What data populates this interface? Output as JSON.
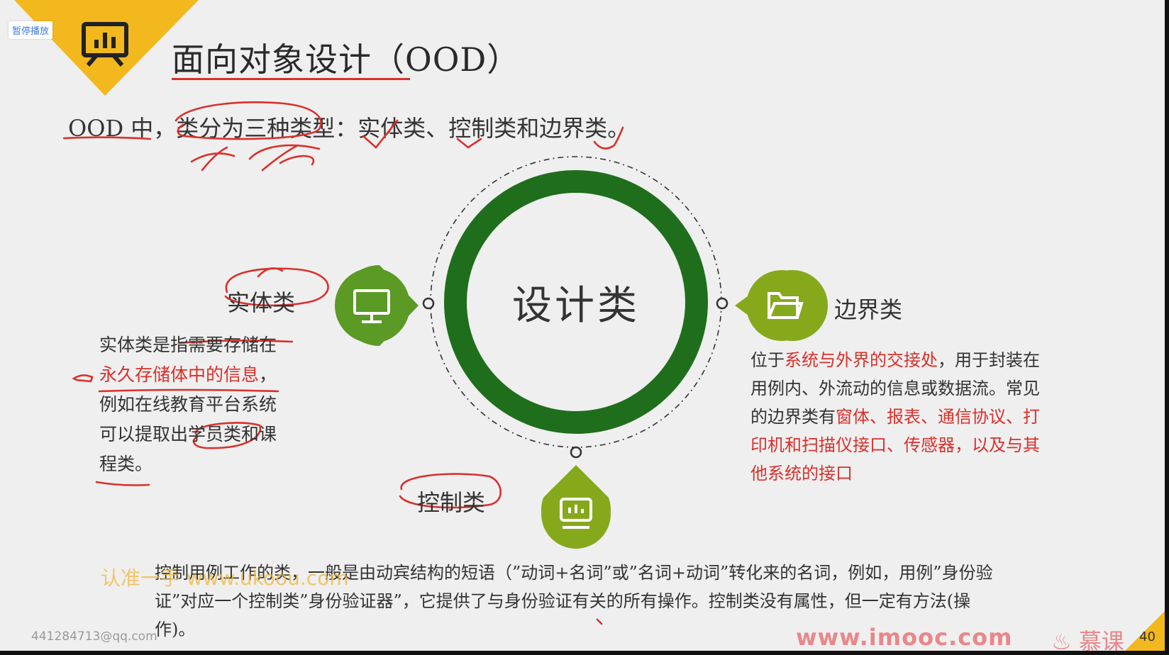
{
  "player": {
    "pause_label": "暂停播放"
  },
  "slide": {
    "title": "面向对象设计（OOD）",
    "intro": "OOD 中，类分为三种类型：实体类、控制类和边界类。",
    "center": "设计类",
    "entity": {
      "label": "实体类",
      "desc_1": "实体类是指需要存储在",
      "desc_2_red": "永久存储体中的信息",
      "desc_2_end": "，",
      "desc_3": "例如在线教育平台系统",
      "desc_4": "可以提取出学员类和课",
      "desc_5": "程类。"
    },
    "boundary": {
      "label": "边界类",
      "desc_1": "位于",
      "desc_1_red": "系统与外界的交接处",
      "desc_1_end": "，用于封装在",
      "desc_2": "用例内、外流动的信息或数据流。常见",
      "desc_3": "的边界类有",
      "desc_3_red": "窗体、报表、通信协议、打",
      "desc_4_red": "印机和扫描仪接口、传感器，以及与其",
      "desc_5_red": "他系统的接口"
    },
    "control": {
      "label": "控制类",
      "desc_1": "控制用例工作的类，一般是由动宾结构的短语（”动词+名词”或”名词+动词”转化来的名词，例如，用例”身份验",
      "desc_2": "证”对应一个控制类”身份验证器”，它提供了与身份验证有关的所有操作。控制类没有属性，但一定有方法(操",
      "desc_3": "作)。"
    },
    "page_number": "40"
  },
  "watermarks": {
    "left": "认准一手 www.ukoou.com",
    "email": "441284713@qq.com",
    "site": "www.imooc.com",
    "brand": "慕课"
  },
  "colors": {
    "accent_yellow": "#f2b81e",
    "ring_green": "#1f6e1c",
    "node_green": "#5a9a25",
    "node_olive": "#86a91c",
    "annotation_red": "#d9302b"
  },
  "icons": {
    "title": "presentation-board-icon",
    "entity": "monitor-icon",
    "boundary": "folder-icon",
    "control": "chart-screen-icon"
  }
}
